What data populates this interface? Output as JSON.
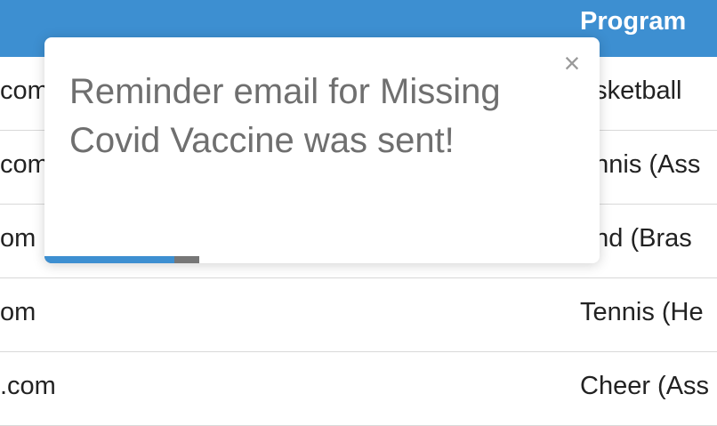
{
  "table": {
    "header": {
      "program_label": "Program"
    },
    "rows": [
      {
        "email": "com",
        "program": "asketball"
      },
      {
        "email": "com",
        "program": "ennis (Ass"
      },
      {
        "email": "om",
        "program": "and (Bras"
      },
      {
        "email": "om",
        "program": "Tennis (He"
      },
      {
        "email": ".com",
        "program": "Cheer (Ass"
      }
    ]
  },
  "toast": {
    "message": "Reminder email for Missing Covid Vaccine was sent!",
    "close_icon": "×",
    "progress": 0.84
  },
  "colors": {
    "header_bg": "#3d8fd1",
    "progress_fill": "#3d8fd1",
    "progress_track": "#777777"
  }
}
